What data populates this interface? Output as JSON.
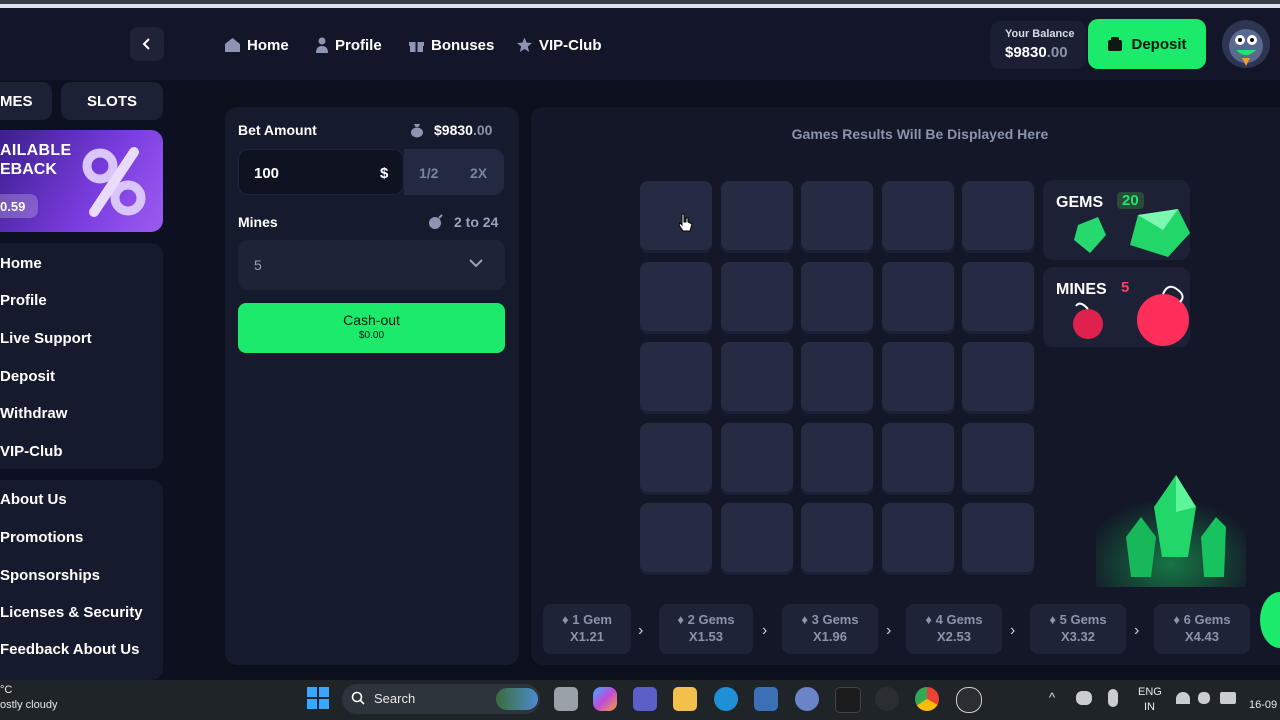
{
  "header": {
    "nav": [
      {
        "label": "Home",
        "icon": "home-icon"
      },
      {
        "label": "Profile",
        "icon": "person-icon"
      },
      {
        "label": "Bonuses",
        "icon": "gift-icon"
      },
      {
        "label": "VIP-Club",
        "icon": "star-icon"
      }
    ],
    "balance_label": "Your Balance",
    "balance_main": "$9830",
    "balance_cents": ".00",
    "deposit_label": "Deposit"
  },
  "sidebar": {
    "tabs": [
      "MES",
      "SLOTS"
    ],
    "rakeback_line1": "AILABLE",
    "rakeback_line2": "EBACK",
    "rakeback_value": "0.59",
    "menu1": [
      "Home",
      "Profile",
      "Live Support",
      "Deposit",
      "Withdraw",
      "VIP-Club"
    ],
    "menu2": [
      "About Us",
      "Promotions",
      "Sponsorships",
      "Licenses & Security",
      "Feedback About Us"
    ]
  },
  "bet": {
    "label": "Bet Amount",
    "balance_main": "$9830",
    "balance_cents": ".00",
    "value": "100",
    "currency": "$",
    "half": "1/2",
    "double": "2X"
  },
  "mines": {
    "label": "Mines",
    "range": "2 to 24",
    "selected": "5"
  },
  "cashout": {
    "label": "Cash-out",
    "amount": "$0.00"
  },
  "game": {
    "results_text": "Games Results Will Be Displayed Here",
    "gems_label": "GEMS",
    "gems_count": "20",
    "mines_label": "MINES",
    "mines_count": "5",
    "grid_rows": 5,
    "grid_cols": 5
  },
  "multipliers": [
    {
      "gems": "1 Gem",
      "mult": "X1.21"
    },
    {
      "gems": "2 Gems",
      "mult": "X1.53"
    },
    {
      "gems": "3 Gems",
      "mult": "X1.96"
    },
    {
      "gems": "4 Gems",
      "mult": "X2.53"
    },
    {
      "gems": "5 Gems",
      "mult": "X3.32"
    },
    {
      "gems": "6 Gems",
      "mult": "X4.43"
    }
  ],
  "taskbar": {
    "weather_temp": "°C",
    "weather_desc": "ostly cloudy",
    "search_label": "Search",
    "lang1": "ENG",
    "lang2": "IN",
    "date": "16-09"
  },
  "colors": {
    "accent_green": "#1bea6a",
    "panel": "#151a2c",
    "tile": "#252b42"
  }
}
